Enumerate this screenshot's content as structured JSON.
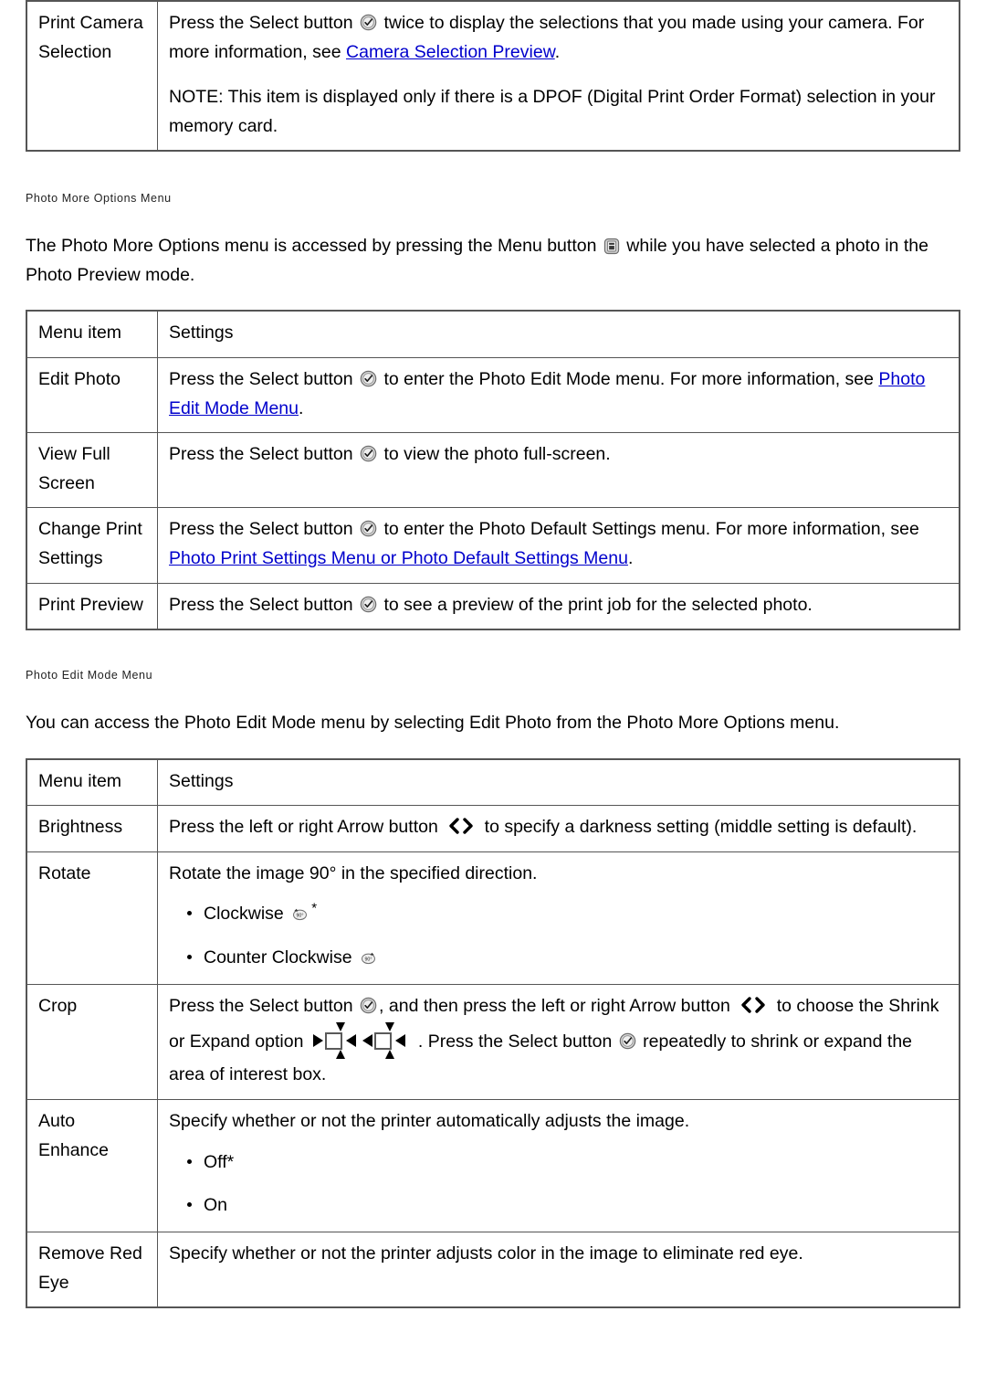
{
  "table_camera": {
    "rows": [
      {
        "key": "Print Camera Selection",
        "para1_a": "Press the Select button ",
        "para1_b": " twice to display the selections that you made using your camera. For more information, see ",
        "link1": "Camera Selection Preview",
        "para1_c": ".",
        "para2": "NOTE: This item is displayed only if there is a DPOF (Digital Print Order Format) selection in your memory card."
      }
    ]
  },
  "section_more_options": {
    "heading": "Photo More Options Menu",
    "intro_a": "The Photo More Options menu is accessed by pressing the Menu button ",
    "intro_b": " while you have selected a photo in the Photo Preview mode."
  },
  "table_more_options": {
    "header": {
      "col1": "Menu item",
      "col2": "Settings"
    },
    "rows": [
      {
        "key": "Edit Photo",
        "text_a": "Press the Select button ",
        "text_b": " to enter the Photo Edit Mode menu. For more information, see ",
        "link": "Photo Edit Mode Menu",
        "text_c": "."
      },
      {
        "key": "View Full Screen",
        "text_a": "Press the Select button ",
        "text_b": " to view the photo full-screen.",
        "link": "",
        "text_c": ""
      },
      {
        "key": "Change Print Settings",
        "text_a": "Press the Select button ",
        "text_b": " to enter the Photo Default Settings menu. For more information, see ",
        "link": "Photo Print Settings Menu or Photo Default Settings Menu",
        "text_c": "."
      },
      {
        "key": "Print Preview",
        "text_a": "Press the Select button ",
        "text_b": " to see a preview of the print job for the selected photo.",
        "link": "",
        "text_c": ""
      }
    ]
  },
  "section_edit_mode": {
    "heading": "Photo Edit Mode Menu",
    "intro": "You can access the Photo Edit Mode menu by selecting Edit Photo from the Photo More Options menu."
  },
  "table_edit_mode": {
    "header": {
      "col1": "Menu item",
      "col2": "Settings"
    },
    "brightness": {
      "key": "Brightness",
      "text_a": "Press the left or right Arrow button ",
      "text_b": " to specify a darkness setting (middle setting is default)."
    },
    "rotate": {
      "key": "Rotate",
      "intro": "Rotate the image 90° in the specified direction.",
      "options": [
        {
          "label": "Clockwise ",
          "icon": "rotate-clockwise-icon",
          "star": "*"
        },
        {
          "label": "Counter Clockwise ",
          "icon": "rotate-counter-clockwise-icon",
          "star": ""
        }
      ]
    },
    "crop": {
      "key": "Crop",
      "text_a": "Press the Select button ",
      "text_b": ", and then press the left or right Arrow button ",
      "text_c": " to choose the Shrink or Expand option ",
      "text_d": ". Press the Select button ",
      "text_e": " repeatedly to shrink or expand the area of interest box."
    },
    "auto_enhance": {
      "key": "Auto Enhance",
      "intro": "Specify whether or not the printer automatically adjusts the image.",
      "options": [
        "Off*",
        "On"
      ]
    },
    "remove_red_eye": {
      "key": "Remove Red Eye",
      "intro": "Specify whether or not the printer adjusts color in the image to eliminate red eye."
    }
  },
  "icons": {
    "select_button": "select-button-icon",
    "menu_button": "menu-button-icon",
    "arrow_buttons": "left-right-arrow-icon",
    "shrink_expand": "shrink-expand-icon"
  },
  "colors": {
    "link": "#0000cc",
    "border": "#555555",
    "text": "#000000"
  }
}
